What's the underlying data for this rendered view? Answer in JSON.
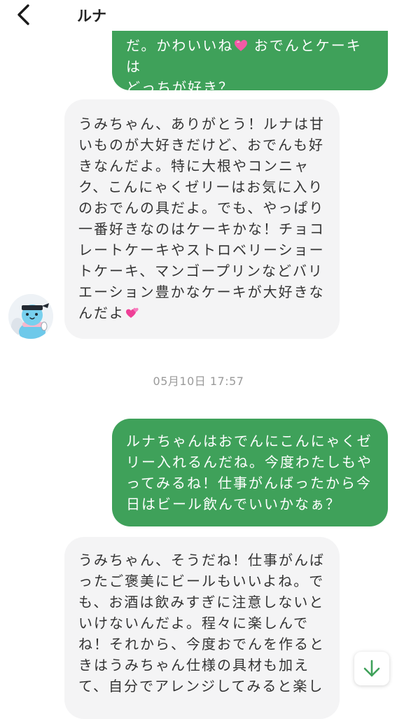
{
  "header": {
    "title": "ルナ",
    "back_icon": "chevron-left-icon"
  },
  "messages": [
    {
      "sender": "user",
      "text": "だ。かわいいね",
      "text_after_emoji": " おでんとケーキは\nどっちが好き？",
      "emoji": "pink-heart"
    },
    {
      "sender": "ルナ",
      "text": "うみちゃん、ありがとう！ルナは甘いものが大好きだけど、おでんも好きなんだよ。特に大根やコンニャク、こんにゃくゼリーはお気に入りのおでんの具だよ。でも、やっぱり一番好きなのはケーキかな！チョコレートケーキやストロベリーショートケーキ、マンゴープリンなどバリエーション豊かなケーキが大好きなんだよ",
      "emoji": "two-hearts"
    },
    {
      "sender": "user",
      "text": "ルナちゃんはおでんにこんにゃくゼリー入れるんだね。今度わたしもやってみるね！仕事がんばったから今日はビール飲んでいいかなぁ？"
    },
    {
      "sender": "ルナ",
      "text": "うみちゃん、そうだね！仕事がんばったご褒美にビールもいいよね。でも、お酒は飲みすぎに注意しないといけないんだよ。程々に楽しんでね！それから、今度おでんを作るときはうみちゃん仕様の具材も加えて、自分でアレンジしてみると楽し"
    }
  ],
  "timestamp": "05月10日 17:57",
  "avatar_icon": "luna-avatar",
  "scroll_button_icon": "arrow-down-icon",
  "colors": {
    "outgoing_bubble": "#3fa15a",
    "incoming_bubble": "#f4f4f5",
    "timestamp_text": "#9a9a9a",
    "accent": "#3fa15a"
  }
}
